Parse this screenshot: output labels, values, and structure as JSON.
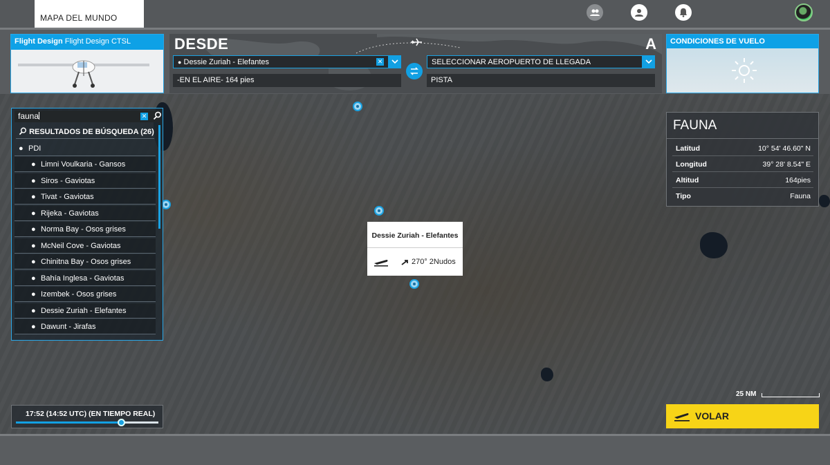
{
  "top_bar": {
    "tab_label": "MAPA DEL MUNDO"
  },
  "aircraft": {
    "brand": "Flight Design",
    "model": "Flight Design CTSL"
  },
  "route": {
    "from_heading": "DESDE",
    "to_heading": "A",
    "departure_value": "Dessie Zuriah - Elefantes",
    "arrival_placeholder": "SELECCIONAR AEROPUERTO DE LLEGADA",
    "departure_status": "-EN EL AIRE- 164 pies",
    "arrival_runway": "PISTA"
  },
  "conditions": {
    "title": "CONDICIONES DE VUELO",
    "icon": "sun-icon"
  },
  "search": {
    "query": "fauna",
    "results_label": "RESULTADOS DE BÚSQUEDA (26)",
    "category": "PDI",
    "items": [
      "Limni Voulkaria - Gansos",
      "Siros - Gaviotas",
      "Tivat - Gaviotas",
      "Rijeka - Gaviotas",
      "Norma Bay - Osos grises",
      "McNeil Cove - Gaviotas",
      "Chinitna Bay - Osos grises",
      "Bahía Inglesa - Gaviotas",
      "Izembek - Osos grises",
      "Dessie Zuriah - Elefantes",
      "Dawunt - Jirafas"
    ]
  },
  "info": {
    "title": "FAUNA",
    "rows": [
      {
        "key": "Latitud",
        "value": "10° 54' 46.60\" N"
      },
      {
        "key": "Longitud",
        "value": "39° 28' 8.54\" E"
      },
      {
        "key": "Altitud",
        "value": "164pies"
      },
      {
        "key": "Tipo",
        "value": "Fauna"
      }
    ]
  },
  "popup": {
    "name": "Dessie Zuriah - Elefantes",
    "wind": "270° 2Nudos"
  },
  "time": {
    "label": "17:52 (14:52 UTC) (EN TIEMPO REAL)",
    "progress": 0.74
  },
  "scale": {
    "label": "25 NM"
  },
  "fly_button": {
    "label": "VOLAR"
  },
  "colors": {
    "accent": "#12a0e3",
    "fly": "#f7d417"
  }
}
